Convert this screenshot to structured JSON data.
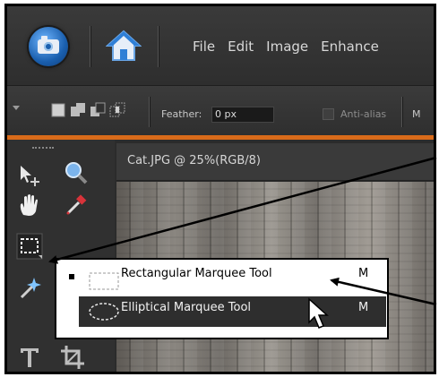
{
  "menubar": {
    "app_icon": "photo-camera-icon",
    "home_icon": "home-icon",
    "items": [
      "File",
      "Edit",
      "Image",
      "Enhance"
    ]
  },
  "options_bar": {
    "feather_label": "Feather:",
    "feather_value": "0 px",
    "antialias_label": "Anti-alias",
    "mode_label_partial": "M"
  },
  "document": {
    "tab_title": "Cat.JPG @ 25%(RGB/8)"
  },
  "flyout": {
    "items": [
      {
        "label": "Rectangular Marquee Tool",
        "shortcut": "M",
        "icon": "rectangular-marquee-icon",
        "selected": true
      },
      {
        "label": "Elliptical Marquee Tool",
        "shortcut": "M",
        "icon": "elliptical-marquee-icon",
        "selected": false
      }
    ]
  },
  "colors": {
    "accent_orange": "#d96b1a",
    "ui_dark": "#2b2b2b",
    "highlight_row": "#2e2e2e"
  }
}
